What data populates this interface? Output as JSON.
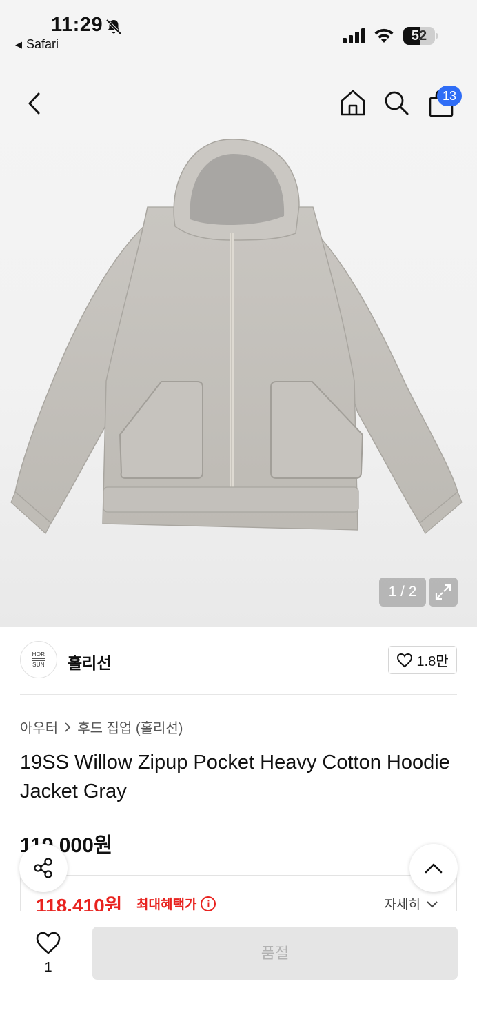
{
  "status_bar": {
    "time": "11:29",
    "back_app": "Safari",
    "battery": "52",
    "battery_level": 0.52
  },
  "header": {
    "cart_count": "13"
  },
  "gallery": {
    "pager": "1 / 2"
  },
  "brand": {
    "logo_top": "HOR",
    "logo_bottom": "SUN",
    "name": "홀리선",
    "likes": "1.8만"
  },
  "breadcrumb": {
    "category": "아우터",
    "subcategory": "후드 집업 (홀리선)"
  },
  "product": {
    "title": "19SS Willow Zipup Pocket Heavy Cotton Hoodie Jacket Gray",
    "price": "119,000원",
    "sale_price": "118,410원",
    "max_benefit": "최대혜택가",
    "detail": "자세히"
  },
  "bottom": {
    "wish_count": "1",
    "sold_out": "품절"
  },
  "colors": {
    "accent_blue": "#2f6df6",
    "sale_red": "#e8231f",
    "disabled_bg": "#e5e5e5"
  }
}
